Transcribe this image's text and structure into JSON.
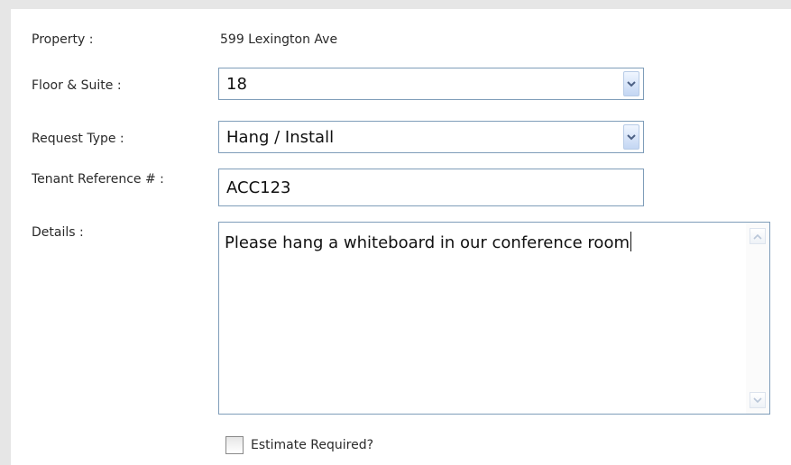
{
  "form": {
    "property": {
      "label": "Property :",
      "value": "599 Lexington Ave"
    },
    "floor_suite": {
      "label": "Floor & Suite :",
      "selected": "18"
    },
    "request_type": {
      "label": "Request Type :",
      "selected": "Hang / Install"
    },
    "tenant_reference": {
      "label": "Tenant Reference # :",
      "value": "ACC123"
    },
    "details": {
      "label": "Details :",
      "value": "Please hang a whiteboard in our conference room"
    },
    "estimate": {
      "label": "Estimate Required?",
      "checked": false
    }
  },
  "colors": {
    "field_border": "#7f9db9",
    "dropdown_button": "#c3d6f3",
    "frame": "#e6e6e6"
  }
}
